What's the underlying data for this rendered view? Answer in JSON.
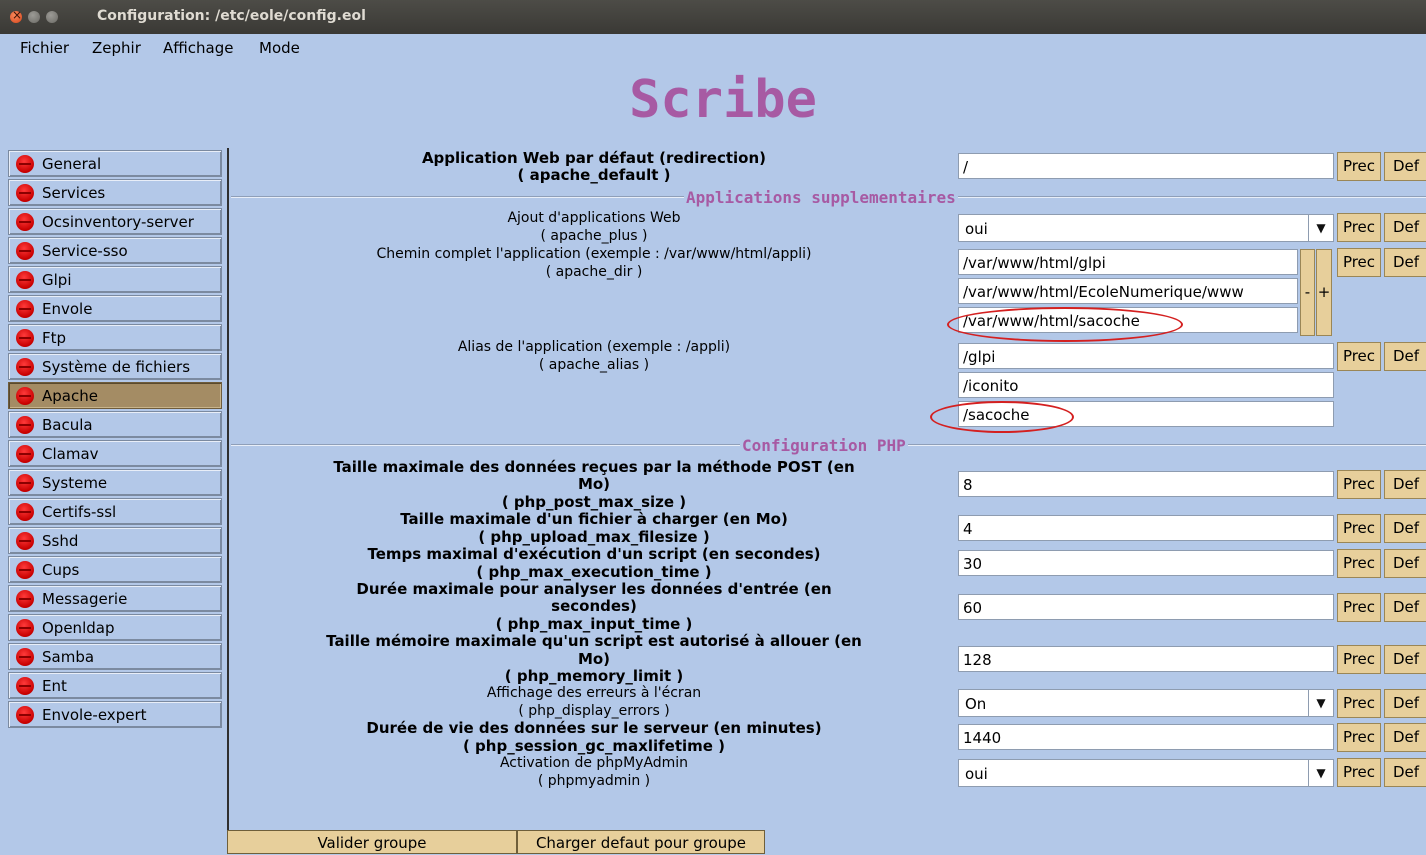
{
  "window": {
    "title": "Configuration: /etc/eole/config.eol"
  },
  "menu": {
    "items": [
      "Fichier",
      "Zephir",
      "Affichage",
      "Mode"
    ]
  },
  "banner": {
    "title": "Scribe"
  },
  "sidebar": {
    "items": [
      "General",
      "Services",
      "Ocsinventory-server",
      "Service-sso",
      "Glpi",
      "Envole",
      "Ftp",
      "Système de fichiers",
      "Apache",
      "Bacula",
      "Clamav",
      "Systeme",
      "Certifs-ssl",
      "Sshd",
      "Cups",
      "Messagerie",
      "Openldap",
      "Samba",
      "Ent",
      "Envole-expert"
    ],
    "active": "Apache"
  },
  "buttons": {
    "prec": "Prec",
    "def": "Def",
    "minus": "-",
    "plus": "+"
  },
  "sections": {
    "apps": "Applications supplementaires",
    "php": "Configuration PHP"
  },
  "fields": {
    "apache_default": {
      "label": "Application Web par défaut (redirection)",
      "key": "( apache_default )",
      "value": "/"
    },
    "apache_plus": {
      "label": "Ajout d'applications Web",
      "key": "( apache_plus )",
      "value": "oui"
    },
    "apache_dir": {
      "label": "Chemin complet l'application (exemple : /var/www/html/appli)",
      "key": "( apache_dir )",
      "values": [
        "/var/www/html/glpi",
        "/var/www/html/EcoleNumerique/www",
        "/var/www/html/sacoche"
      ]
    },
    "apache_alias": {
      "label": "Alias de l'application (exemple : /appli)",
      "key": "( apache_alias )",
      "values": [
        "/glpi",
        "/iconito",
        "/sacoche"
      ]
    },
    "php_post_max_size": {
      "label1": "Taille maximale des données reçues par la méthode POST (en",
      "label2": "Mo)",
      "key": "( php_post_max_size )",
      "value": "8"
    },
    "php_upload_max_filesize": {
      "label": "Taille maximale d'un fichier à charger (en Mo)",
      "key": "( php_upload_max_filesize )",
      "value": "4"
    },
    "php_max_execution_time": {
      "label": "Temps maximal d'exécution d'un script (en secondes)",
      "key": "( php_max_execution_time )",
      "value": "30"
    },
    "php_max_input_time": {
      "label1": "Durée maximale pour analyser les données d'entrée (en",
      "label2": "secondes)",
      "key": "( php_max_input_time )",
      "value": "60"
    },
    "php_memory_limit": {
      "label1": "Taille mémoire maximale qu'un script est autorisé à allouer (en",
      "label2": "Mo)",
      "key": "( php_memory_limit )",
      "value": "128"
    },
    "php_display_errors": {
      "label": "Affichage des erreurs à l'écran",
      "key": "( php_display_errors )",
      "value": "On"
    },
    "php_session_gc_maxlifetime": {
      "label": "Durée de vie des données sur le serveur (en minutes)",
      "key": "( php_session_gc_maxlifetime )",
      "value": "1440"
    },
    "phpmyadmin": {
      "label": "Activation de phpMyAdmin",
      "key": "( phpmyadmin )",
      "value": "oui"
    }
  },
  "bottom": {
    "validate": "Valider groupe",
    "load_default": "Charger defaut pour groupe"
  }
}
